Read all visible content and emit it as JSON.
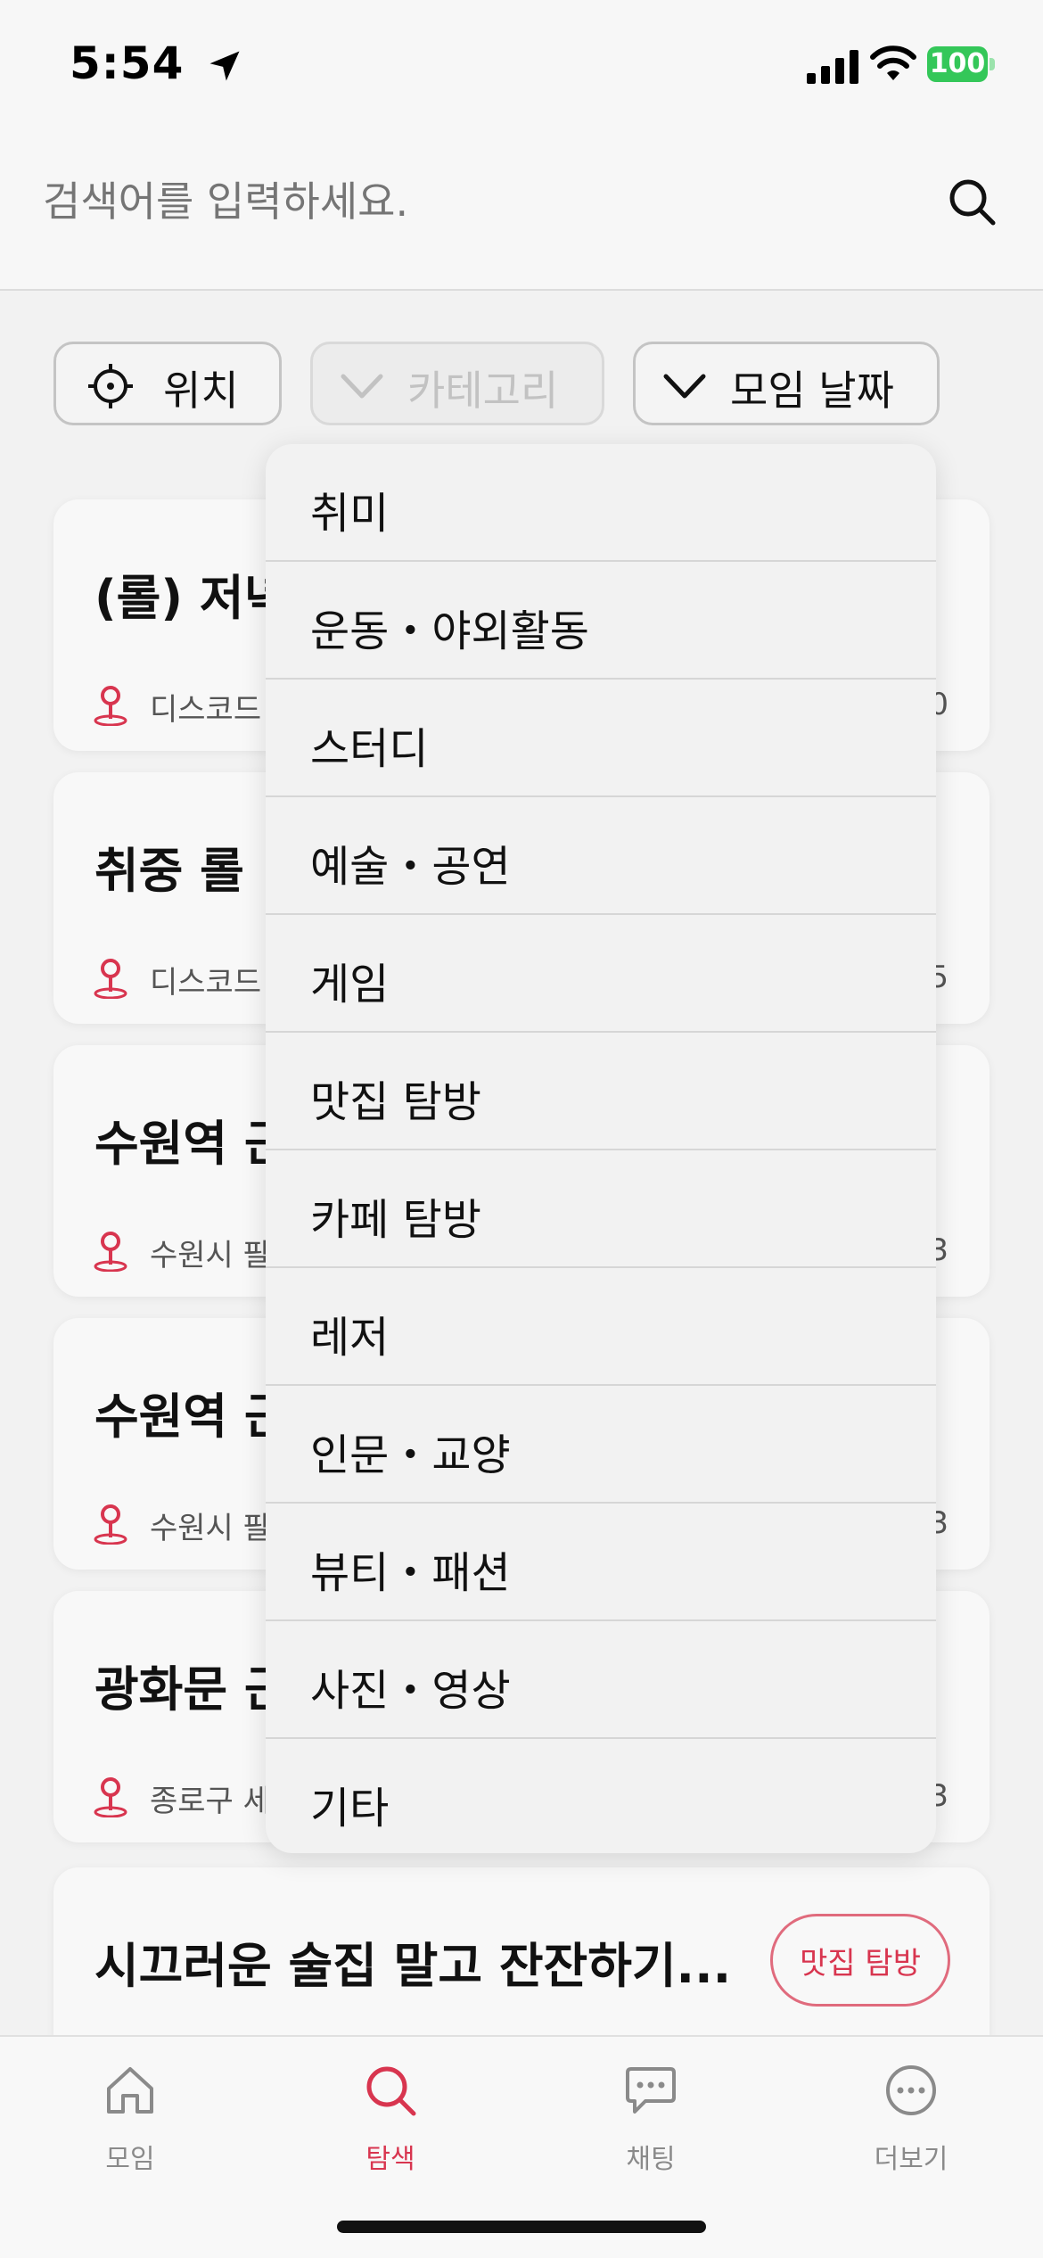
{
  "status": {
    "time": "5:54",
    "battery": "100"
  },
  "search": {
    "placeholder": "검색어를 입력하세요."
  },
  "filters": {
    "location": "위치",
    "category": "카테고리",
    "date": "모임 날짜"
  },
  "cards": [
    {
      "title": "(롤) 저녁",
      "location": "디스코드",
      "num": "0",
      "badge": ""
    },
    {
      "title": "취중 롤",
      "location": "디스코드",
      "num": "5",
      "badge": ""
    },
    {
      "title": "수원역 근",
      "location": "수원시 팔",
      "num": "3",
      "badge": ""
    },
    {
      "title": "수원역 근",
      "location": "수원시 팔",
      "num": "3",
      "badge": ""
    },
    {
      "title": "광화문 근",
      "location": "종로구 세",
      "num": "3",
      "badge": ""
    },
    {
      "title": "시끄러운 술집 말고 잔잔하기...",
      "location": "",
      "num": "",
      "badge": "맛집 탐방"
    }
  ],
  "dropdown": {
    "items": [
      "취미",
      "운동・야외활동",
      "스터디",
      "예술・공연",
      "게임",
      "맛집 탐방",
      "카페 탐방",
      "레저",
      "인문・교양",
      "뷰티・패션",
      "사진・영상",
      "기타"
    ]
  },
  "tabs": [
    {
      "label": "모임",
      "icon": "home-icon"
    },
    {
      "label": "탐색",
      "icon": "search-icon",
      "active": true
    },
    {
      "label": "채팅",
      "icon": "chat-icon"
    },
    {
      "label": "더보기",
      "icon": "more-icon"
    }
  ],
  "colors": {
    "accent": "#d8354f",
    "battery": "#34c759"
  }
}
